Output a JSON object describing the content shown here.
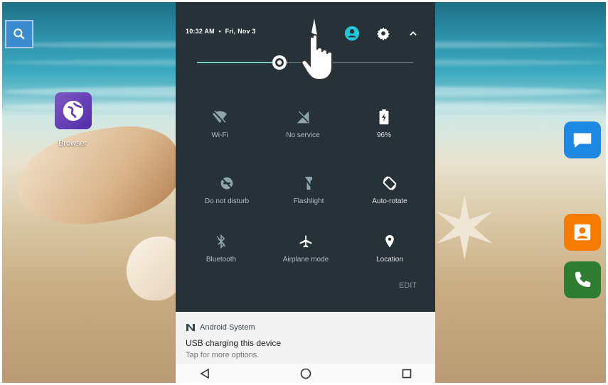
{
  "status": {
    "time": "10:32 AM",
    "separator": "•",
    "date": "Fri, Nov 3"
  },
  "brightness": {
    "level": 0.38
  },
  "tiles": [
    {
      "label": "Wi-Fi",
      "icon": "wifi-off-icon"
    },
    {
      "label": "No service",
      "icon": "no-signal-icon"
    },
    {
      "label": "96%",
      "icon": "battery-charging-icon"
    },
    {
      "label": "Do not disturb",
      "icon": "do-not-disturb-icon"
    },
    {
      "label": "Flashlight",
      "icon": "flashlight-off-icon"
    },
    {
      "label": "Auto-rotate",
      "icon": "auto-rotate-icon"
    },
    {
      "label": "Bluetooth",
      "icon": "bluetooth-off-icon"
    },
    {
      "label": "Airplane mode",
      "icon": "airplane-icon"
    },
    {
      "label": "Location",
      "icon": "location-icon"
    }
  ],
  "edit_label": "EDIT",
  "notification": {
    "app": "Android System",
    "title": "USB charging this device",
    "subtitle": "Tap for more options."
  },
  "desktop": {
    "browser_label": "Browser"
  },
  "colors": {
    "shade_bg": "#263238",
    "accent": "#80cbc4",
    "account": "#26c6da"
  }
}
